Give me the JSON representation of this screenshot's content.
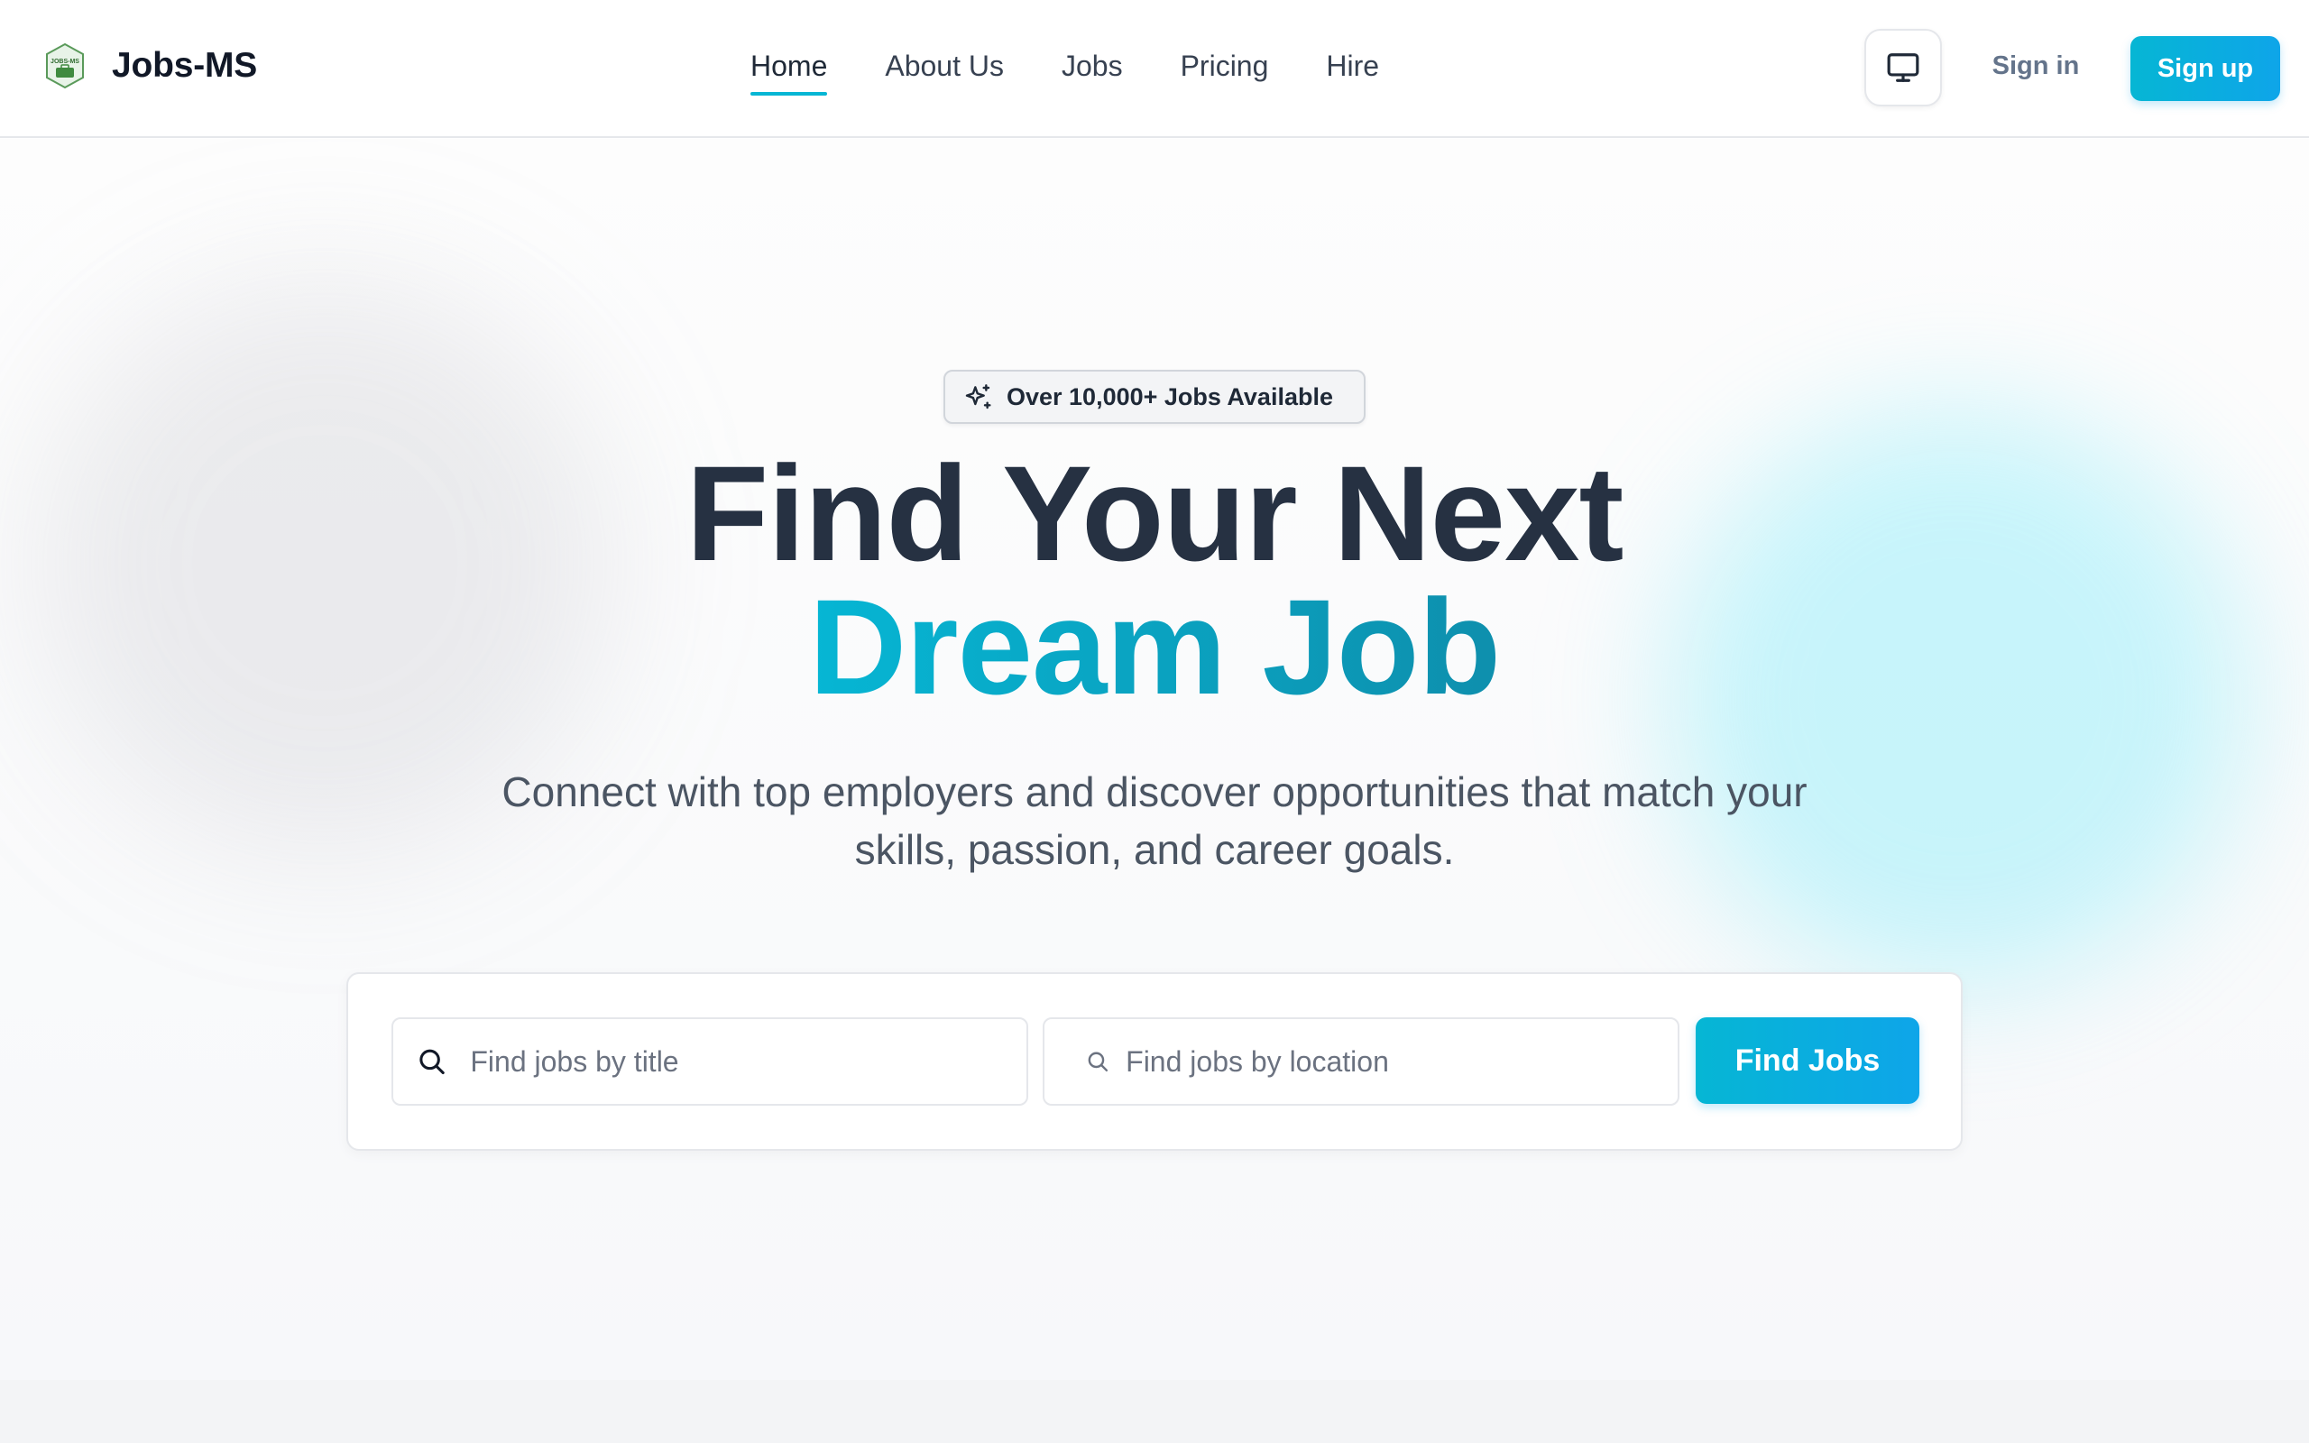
{
  "brand": {
    "name": "Jobs-MS",
    "logo_text": "JOBS-MS"
  },
  "nav": {
    "items": [
      {
        "label": "Home",
        "active": true
      },
      {
        "label": "About Us",
        "active": false
      },
      {
        "label": "Jobs",
        "active": false
      },
      {
        "label": "Pricing",
        "active": false
      },
      {
        "label": "Hire",
        "active": false
      }
    ]
  },
  "header_actions": {
    "theme_icon": "monitor-icon",
    "signin_label": "Sign in",
    "signup_label": "Sign up"
  },
  "hero": {
    "badge_icon": "sparkles-icon",
    "badge_text": "Over 10,000+ Jobs Available",
    "title_line1": "Find Your Next",
    "title_line2": "Dream Job",
    "subtitle_line1": "Connect with top employers and discover opportunities that match your",
    "subtitle_line2": "skills, passion, and career goals."
  },
  "search": {
    "title_placeholder": "Find jobs by title",
    "location_placeholder": "Find jobs by location",
    "title_value": "",
    "location_value": "",
    "submit_label": "Find Jobs"
  },
  "colors": {
    "accent": "#06b6d4",
    "accent_end": "#0ea5e9",
    "heading": "#263142",
    "body_text": "#4b5563"
  }
}
